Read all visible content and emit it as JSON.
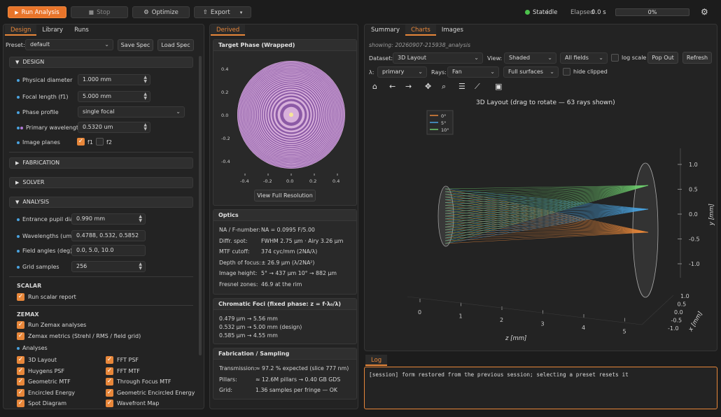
{
  "toolbar": {
    "run": "Run Analysis",
    "stop": "Stop",
    "optimize": "Optimize",
    "export": "Export",
    "state_label": "State",
    "state_value": "idle",
    "elapsed_label": "Elapsed",
    "elapsed_value": "0.0 s",
    "progress": "0%",
    "progress_value": 0
  },
  "left": {
    "tabs": [
      "Design",
      "Library",
      "Runs"
    ],
    "preset_label": "Preset:",
    "preset_value": "default",
    "save_spec": "Save Spec",
    "load_spec": "Load Spec",
    "design": {
      "header": "DESIGN",
      "physical_diameter_label": "Physical diameter",
      "physical_diameter": "1.000 mm",
      "focal_length_label": "Focal length (f1)",
      "focal_length": "5.000 mm",
      "phase_profile_label": "Phase profile",
      "phase_profile": "single focal",
      "primary_wavelength_label": "Primary wavelength",
      "primary_wavelength": "0.5320 um",
      "image_planes_label": "Image planes",
      "f1": "f1",
      "f2": "f2"
    },
    "fabrication": "FABRICATION",
    "solver": "SOLVER",
    "analysis": {
      "header": "ANALYSIS",
      "pupil_label": "Entrance pupil dia.",
      "pupil": "0.990 mm",
      "wavelengths_label": "Wavelengths (um)",
      "wavelengths": "0.4788, 0.532, 0.5852",
      "field_label": "Field angles (deg)",
      "field": "0.0, 5.0, 10.0",
      "grid_label": "Grid samples",
      "grid": "256"
    },
    "scalar": {
      "header": "SCALAR",
      "run_scalar": "Run scalar report"
    },
    "zemax": {
      "header": "ZEMAX",
      "run_zemax": "Run Zemax analyses",
      "metrics": "Zemax metrics (Strehl / RMS / field grid)",
      "analyses_label": "Analyses",
      "items_left": [
        "3D Layout",
        "Huygens PSF",
        "Geometric MTF",
        "Encircled Energy",
        "Spot Diagram"
      ],
      "items_right": [
        "FFT PSF",
        "FFT MTF",
        "Through Focus MTF",
        "Geometric Encircled Energy",
        "Wavefront Map"
      ]
    }
  },
  "middle": {
    "tab": "Derived",
    "phase_title": "Target Phase (Wrapped)",
    "phase_yticks": [
      "0.4",
      "0.2",
      "0.0",
      "-0.2",
      "-0.4"
    ],
    "phase_xticks": [
      "-0.4",
      "-0.2",
      "0.0",
      "0.2",
      "0.4"
    ],
    "view_full": "View Full Resolution",
    "optics_title": "Optics",
    "optics_rows": [
      [
        "NA / F-number:",
        "NA = 0.0995   F/5.00"
      ],
      [
        "Diffr. spot:",
        "FWHM 2.75 µm · Airy 3.26 µm"
      ],
      [
        "MTF cutoff:",
        "374 cyc/mm   (2NA/λ)"
      ],
      [
        "Depth of focus:",
        "± 26.9 µm   (λ/2NA²)"
      ],
      [
        "Image height:",
        "5° → 437 µm   10° → 882 µm"
      ],
      [
        "Fresnel zones:",
        "46.9 at the rim"
      ]
    ],
    "chromatic_title": "Chromatic Foci  (fixed phase: z = f·λ₀/λ)",
    "chromatic_rows": [
      "0.479 µm  →  5.56 mm",
      "0.532 µm  →  5.00 mm   (design)",
      "0.585 µm  →  4.55 mm"
    ],
    "fab_title": "Fabrication / Sampling",
    "fab_rows": [
      [
        "Transmission:",
        "≈ 97.2 % expected   (slice 777 nm)"
      ],
      [
        "Pillars:",
        "≈ 12.6M pillars  →  0.40 GB GDS"
      ],
      [
        "Grid:",
        "1.36 samples per fringe   — OK"
      ]
    ]
  },
  "right": {
    "tabs": [
      "Summary",
      "Charts",
      "Images"
    ],
    "showing": "showing: 20260907-215938_analysis",
    "dataset_label": "Dataset:",
    "dataset": "3D Layout",
    "view_label": "View:",
    "view": "Shaded",
    "fields": "All fields",
    "log_scale": "log scale",
    "pop_out": "Pop Out",
    "refresh": "Refresh",
    "lambda_label": "λ:",
    "lambda": "primary",
    "rays_label": "Rays:",
    "rays": "Fan",
    "surfaces": "Full surfaces",
    "hide_clipped": "hide clipped"
  },
  "chart_data": {
    "type": "3d-layout",
    "title": "3D Layout   (drag to rotate — 63 rays shown)",
    "legend": [
      "0°",
      "5°",
      "10°"
    ],
    "colors": {
      "0°": "#e8873a",
      "5°": "#4aa3df",
      "10°": "#6fcf6f"
    },
    "z_ticks": [
      "0",
      "1",
      "2",
      "3",
      "4",
      "5"
    ],
    "z_label": "z [mm]",
    "y_ticks": [
      "1.0",
      "0.5",
      "0.0",
      "-0.5",
      "-1.0"
    ],
    "y_label": "y [mm]",
    "x_ticks": [
      "1.0",
      "0.5",
      "0.0",
      "-0.5",
      "-1.0"
    ],
    "x_label": "x [mm]",
    "rays_shown": 63
  },
  "log": {
    "tab": "Log",
    "text": "[session] form restored from the previous session; selecting a preset resets it"
  }
}
